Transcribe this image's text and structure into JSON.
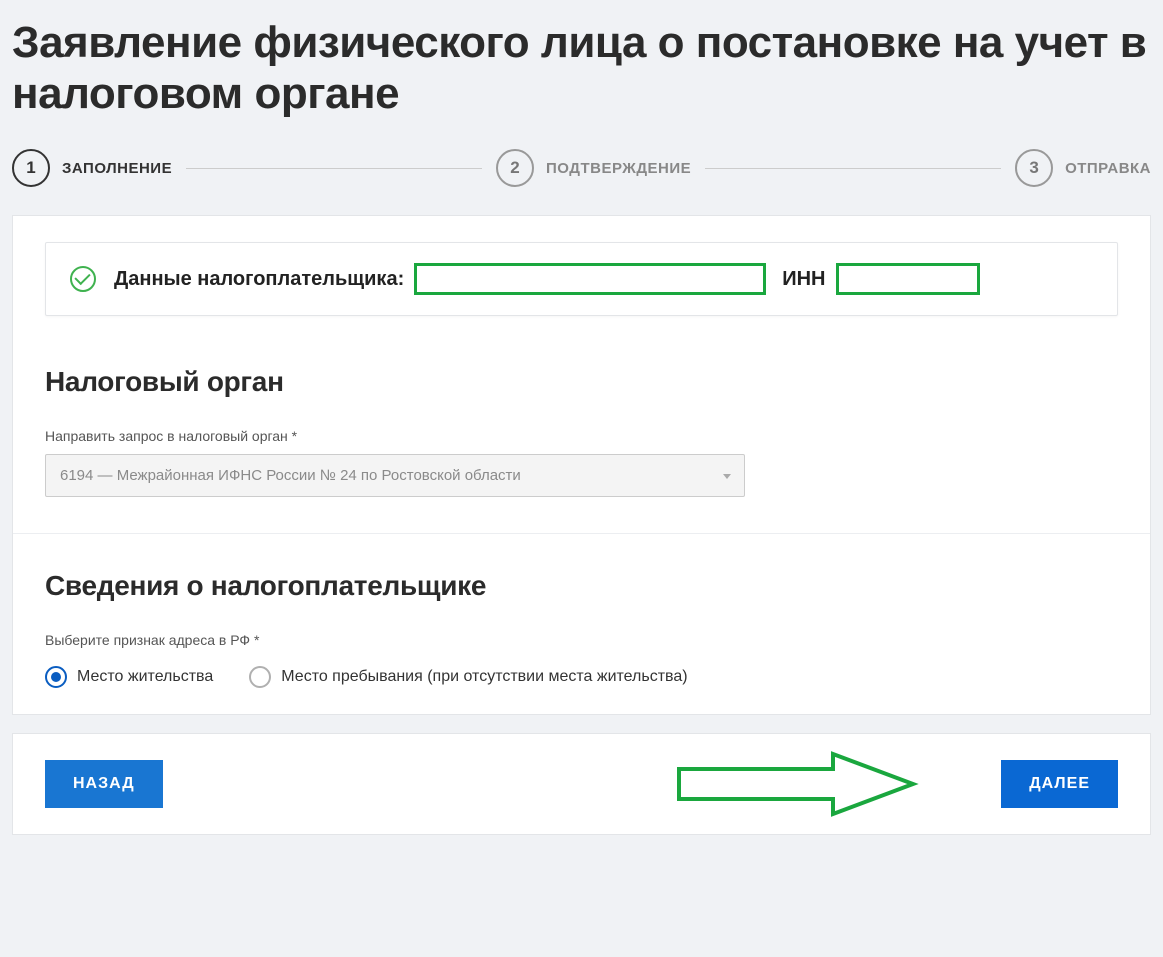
{
  "page_title": "Заявление физического лица о постановке на учет в налоговом органе",
  "stepper": {
    "steps": [
      {
        "num": "1",
        "label": "ЗАПОЛНЕНИЕ",
        "active": true
      },
      {
        "num": "2",
        "label": "ПОДТВЕРЖДЕНИЕ",
        "active": false
      },
      {
        "num": "3",
        "label": "ОТПРАВКА",
        "active": false
      }
    ]
  },
  "taxpayer_block": {
    "label": "Данные налогоплательщика:",
    "name_value": "",
    "inn_label": "ИНН",
    "inn_value": ""
  },
  "tax_authority": {
    "title": "Налоговый орган",
    "field_label": "Направить запрос в налоговый орган *",
    "selected": "6194 — Межрайонная ИФНС России № 24 по Ростовской области"
  },
  "taxpayer_info": {
    "title": "Сведения о налогоплательщике",
    "field_label": "Выберите признак адреса в РФ *",
    "options": [
      {
        "label": "Место жительства",
        "selected": true
      },
      {
        "label": "Место пребывания (при отсутствии места жительства)",
        "selected": false
      }
    ]
  },
  "footer": {
    "back_label": "НАЗАД",
    "next_label": "ДАЛЕЕ"
  },
  "colors": {
    "green": "#1aa73e",
    "blue": "#0a68d3"
  }
}
